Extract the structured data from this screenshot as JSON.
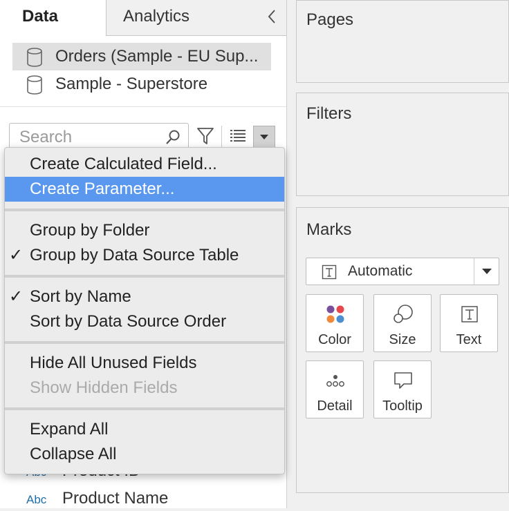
{
  "tabs": {
    "data_label": "Data",
    "analytics_label": "Analytics"
  },
  "data_sources": [
    {
      "label": "Orders (Sample - EU Sup...",
      "selected": true
    },
    {
      "label": "Sample - Superstore",
      "selected": false
    }
  ],
  "search": {
    "placeholder": "Search",
    "value": ""
  },
  "context_menu": {
    "items": [
      {
        "label": "Create Calculated Field...",
        "checked": false,
        "highlighted": false,
        "disabled": false
      },
      {
        "label": "Create Parameter...",
        "checked": false,
        "highlighted": true,
        "disabled": false
      },
      {
        "label": "Group by Folder",
        "checked": false,
        "highlighted": false,
        "disabled": false
      },
      {
        "label": "Group by Data Source Table",
        "checked": true,
        "highlighted": false,
        "disabled": false
      },
      {
        "label": "Sort by Name",
        "checked": true,
        "highlighted": false,
        "disabled": false
      },
      {
        "label": "Sort by Data Source Order",
        "checked": false,
        "highlighted": false,
        "disabled": false
      },
      {
        "label": "Hide All Unused Fields",
        "checked": false,
        "highlighted": false,
        "disabled": false
      },
      {
        "label": "Show Hidden Fields",
        "checked": false,
        "highlighted": false,
        "disabled": true
      },
      {
        "label": "Expand All",
        "checked": false,
        "highlighted": false,
        "disabled": false
      },
      {
        "label": "Collapse All",
        "checked": false,
        "highlighted": false,
        "disabled": false
      }
    ],
    "check_glyph": "✓"
  },
  "fields": [
    {
      "type": "Abc",
      "name": "Product ID"
    },
    {
      "type": "Abc",
      "name": "Product Name"
    }
  ],
  "shelves": {
    "pages_title": "Pages",
    "filters_title": "Filters",
    "marks_title": "Marks"
  },
  "marks": {
    "type_label": "Automatic",
    "buttons": [
      {
        "label": "Color",
        "icon": "color-dots-icon"
      },
      {
        "label": "Size",
        "icon": "size-circles-icon"
      },
      {
        "label": "Text",
        "icon": "text-t-icon"
      },
      {
        "label": "Detail",
        "icon": "detail-dots-icon"
      },
      {
        "label": "Tooltip",
        "icon": "speech-bubble-icon"
      }
    ]
  },
  "colors": {
    "highlight": "#5a98f0",
    "field_type": "#1f6da8",
    "color_dots": [
      "#7b4e9c",
      "#e8474b",
      "#f08a3a",
      "#4b8fd0"
    ]
  }
}
